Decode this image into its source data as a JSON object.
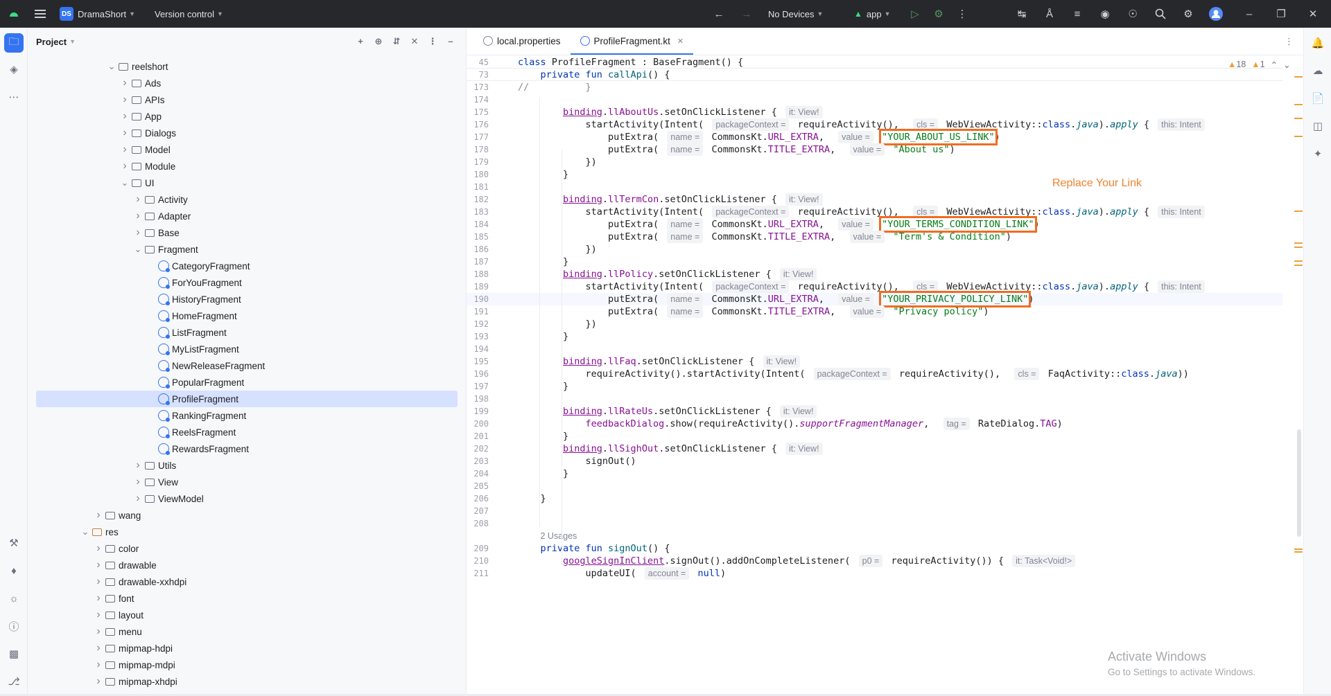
{
  "titlebar": {
    "project_badge": "DS",
    "project_name": "DramaShort",
    "vcs": "Version control",
    "devices": "No Devices",
    "run_config": "app"
  },
  "panel": {
    "title": "Project"
  },
  "tree": [
    {
      "label": "reelshort",
      "depth": 5,
      "open": true,
      "kind": "folder"
    },
    {
      "label": "Ads",
      "depth": 6,
      "kind": "folder"
    },
    {
      "label": "APIs",
      "depth": 6,
      "kind": "folder"
    },
    {
      "label": "App",
      "depth": 6,
      "kind": "folder"
    },
    {
      "label": "Dialogs",
      "depth": 6,
      "kind": "folder"
    },
    {
      "label": "Model",
      "depth": 6,
      "kind": "folder"
    },
    {
      "label": "Module",
      "depth": 6,
      "kind": "folder"
    },
    {
      "label": "UI",
      "depth": 6,
      "open": true,
      "kind": "folder"
    },
    {
      "label": "Activity",
      "depth": 7,
      "kind": "folder"
    },
    {
      "label": "Adapter",
      "depth": 7,
      "kind": "folder"
    },
    {
      "label": "Base",
      "depth": 7,
      "kind": "folder"
    },
    {
      "label": "Fragment",
      "depth": 7,
      "open": true,
      "kind": "folder"
    },
    {
      "label": "CategoryFragment",
      "depth": 8,
      "kind": "class"
    },
    {
      "label": "ForYouFragment",
      "depth": 8,
      "kind": "class"
    },
    {
      "label": "HistoryFragment",
      "depth": 8,
      "kind": "class"
    },
    {
      "label": "HomeFragment",
      "depth": 8,
      "kind": "class"
    },
    {
      "label": "ListFragment",
      "depth": 8,
      "kind": "class"
    },
    {
      "label": "MyListFragment",
      "depth": 8,
      "kind": "class"
    },
    {
      "label": "NewReleaseFragment",
      "depth": 8,
      "kind": "class"
    },
    {
      "label": "PopularFragment",
      "depth": 8,
      "kind": "class"
    },
    {
      "label": "ProfileFragment",
      "depth": 8,
      "kind": "class",
      "selected": true
    },
    {
      "label": "RankingFragment",
      "depth": 8,
      "kind": "class"
    },
    {
      "label": "ReelsFragment",
      "depth": 8,
      "kind": "class"
    },
    {
      "label": "RewardsFragment",
      "depth": 8,
      "kind": "class"
    },
    {
      "label": "Utils",
      "depth": 7,
      "kind": "folder"
    },
    {
      "label": "View",
      "depth": 7,
      "kind": "folder"
    },
    {
      "label": "ViewModel",
      "depth": 7,
      "kind": "folder"
    },
    {
      "label": "wang",
      "depth": 4,
      "kind": "folder"
    },
    {
      "label": "res",
      "depth": 3,
      "open": true,
      "kind": "res"
    },
    {
      "label": "color",
      "depth": 4,
      "kind": "folder"
    },
    {
      "label": "drawable",
      "depth": 4,
      "kind": "folder"
    },
    {
      "label": "drawable-xxhdpi",
      "depth": 4,
      "kind": "folder"
    },
    {
      "label": "font",
      "depth": 4,
      "kind": "folder"
    },
    {
      "label": "layout",
      "depth": 4,
      "kind": "folder"
    },
    {
      "label": "menu",
      "depth": 4,
      "kind": "folder"
    },
    {
      "label": "mipmap-hdpi",
      "depth": 4,
      "kind": "folder"
    },
    {
      "label": "mipmap-mdpi",
      "depth": 4,
      "kind": "folder"
    },
    {
      "label": "mipmap-xhdpi",
      "depth": 4,
      "kind": "folder"
    }
  ],
  "tabs": [
    {
      "label": "local.properties"
    },
    {
      "label": "ProfileFragment.kt"
    }
  ],
  "inspections": {
    "warnings": "18",
    "weak": "1"
  },
  "annotation": "Replace Your Link",
  "watermark": {
    "title": "Activate Windows",
    "subtitle": "Go to Settings to activate Windows."
  },
  "code": [
    {
      "n": "45",
      "html": "<span class='kw'>class</span> ProfileFragment : BaseFragment() {",
      "sticky": true,
      "indent": 0
    },
    {
      "n": "73",
      "html": "<span class='kw'>private fun</span> <span class='fn'>callApi</span>() {",
      "sticky": true,
      "indent": 1
    },
    {
      "n": "173",
      "html": "<span class='cmt'>//</span>          <span class='cmt'>}</span>",
      "indent": 0
    },
    {
      "n": "174",
      "html": "",
      "indent": 0
    },
    {
      "n": "175",
      "html": "<span class='bind'>binding</span>.<span class='prop'>llAboutUs</span>.setOnClickListener { <span class='hint'>it: View!</span>",
      "indent": 2
    },
    {
      "n": "176",
      "html": "startActivity(Intent( <span class='hint'>packageContext =</span> requireActivity(),  <span class='hint'>cls =</span> WebViewActivity::<span class='kw'>class</span>.<span class='it'>java</span>).<span class='it'>apply</span> { <span class='hint'>this: Intent</span>",
      "indent": 3
    },
    {
      "n": "177",
      "html": "putExtra( <span class='hint'>name =</span> CommonsKt.<span class='prop'>URL_EXTRA</span>,  <span class='hint'>value =</span> <span class='str hl'>\"YOUR_ABOUT_US_LINK\"</span>)",
      "indent": 4
    },
    {
      "n": "178",
      "html": "putExtra( <span class='hint'>name =</span> CommonsKt.<span class='prop'>TITLE_EXTRA</span>,  <span class='hint'>value =</span> <span class='str'>\"About us\"</span>)",
      "indent": 4
    },
    {
      "n": "179",
      "html": "})",
      "indent": 3
    },
    {
      "n": "180",
      "html": "}",
      "indent": 2
    },
    {
      "n": "181",
      "html": "",
      "indent": 0
    },
    {
      "n": "182",
      "html": "<span class='bind'>binding</span>.<span class='prop'>llTermCon</span>.setOnClickListener { <span class='hint'>it: View!</span>",
      "indent": 2
    },
    {
      "n": "183",
      "html": "startActivity(Intent( <span class='hint'>packageContext =</span> requireActivity(),  <span class='hint'>cls =</span> WebViewActivity::<span class='kw'>class</span>.<span class='it'>java</span>).<span class='it'>apply</span> { <span class='hint'>this: Intent</span>",
      "indent": 3
    },
    {
      "n": "184",
      "html": "putExtra( <span class='hint'>name =</span> CommonsKt.<span class='prop'>URL_EXTRA</span>,  <span class='hint'>value =</span> <span class='str hl'>\"YOUR_TERMS_CONDITION_LINK\"</span>)",
      "indent": 4
    },
    {
      "n": "185",
      "html": "putExtra( <span class='hint'>name =</span> CommonsKt.<span class='prop'>TITLE_EXTRA</span>,  <span class='hint'>value =</span> <span class='str'>\"Term's &amp; Condition\"</span>)",
      "indent": 4
    },
    {
      "n": "186",
      "html": "})",
      "indent": 3
    },
    {
      "n": "187",
      "html": "}",
      "indent": 2
    },
    {
      "n": "188",
      "html": "<span class='bind'>binding</span>.<span class='prop'>llPolicy</span>.setOnClickListener { <span class='hint'>it: View!</span>",
      "indent": 2
    },
    {
      "n": "189",
      "html": "startActivity(Intent( <span class='hint'>packageContext =</span> requireActivity(),  <span class='hint'>cls =</span> WebViewActivity::<span class='kw'>class</span>.<span class='it'>java</span>).<span class='it'>apply</span> { <span class='hint'>this: Intent</span>",
      "indent": 3
    },
    {
      "n": "190",
      "html": "putExtra( <span class='hint'>name =</span> CommonsKt.<span class='prop'>URL_EXTRA</span>,  <span class='hint'>value =</span> <span class='str hl'>\"YOUR_PRIVACY_POLICY_LINK\"</span>)",
      "indent": 4,
      "current": true
    },
    {
      "n": "191",
      "html": "putExtra( <span class='hint'>name =</span> CommonsKt.<span class='prop'>TITLE_EXTRA</span>,  <span class='hint'>value =</span> <span class='str'>\"Privacy policy\"</span>)",
      "indent": 4
    },
    {
      "n": "192",
      "html": "})",
      "indent": 3
    },
    {
      "n": "193",
      "html": "}",
      "indent": 2
    },
    {
      "n": "194",
      "html": "",
      "indent": 0
    },
    {
      "n": "195",
      "html": "<span class='bind'>binding</span>.<span class='prop'>llFaq</span>.setOnClickListener { <span class='hint'>it: View!</span>",
      "indent": 2
    },
    {
      "n": "196",
      "html": "requireActivity().startActivity(Intent( <span class='hint'>packageContext =</span> requireActivity(),  <span class='hint'>cls =</span> FaqActivity::<span class='kw'>class</span>.<span class='it'>java</span>))",
      "indent": 3
    },
    {
      "n": "197",
      "html": "}",
      "indent": 2
    },
    {
      "n": "198",
      "html": "",
      "indent": 0
    },
    {
      "n": "199",
      "html": "<span class='bind'>binding</span>.<span class='prop'>llRateUs</span>.setOnClickListener { <span class='hint'>it: View!</span>",
      "indent": 2
    },
    {
      "n": "200",
      "html": "<span class='prop'>feedbackDialog</span>.show(requireActivity().<span class='it' style='color:#871094'>supportFragmentManager</span>,  <span class='hint'>tag =</span> RateDialog.<span class='prop'>TAG</span>)",
      "indent": 3
    },
    {
      "n": "201",
      "html": "}",
      "indent": 2
    },
    {
      "n": "202",
      "html": "<span class='bind'>binding</span>.<span class='prop'>llSighOut</span>.setOnClickListener { <span class='hint'>it: View!</span>",
      "indent": 2
    },
    {
      "n": "203",
      "html": "signOut()",
      "indent": 3
    },
    {
      "n": "204",
      "html": "}",
      "indent": 2
    },
    {
      "n": "205",
      "html": "",
      "indent": 0
    },
    {
      "n": "206",
      "html": "}",
      "indent": 1
    },
    {
      "n": "207",
      "html": "",
      "indent": 0
    },
    {
      "n": "208",
      "html": "",
      "indent": 0
    },
    {
      "n": "",
      "html": "<span class='usages'>2 Usages</span>",
      "indent": 1
    },
    {
      "n": "209",
      "html": "<span class='kw'>private fun</span> <span class='fn'>signOut</span>() {",
      "indent": 1
    },
    {
      "n": "210",
      "html": "<span class='bind'>googleSignInClient</span>.signOut().addOnCompleteListener( <span class='hint'>p0 =</span> requireActivity()) { <span class='hint'>it: Task&lt;Void!&gt;</span>",
      "indent": 2
    },
    {
      "n": "211",
      "html": "updateUI( <span class='hint'>account =</span> <span class='kw'>null</span>)",
      "indent": 3
    }
  ]
}
